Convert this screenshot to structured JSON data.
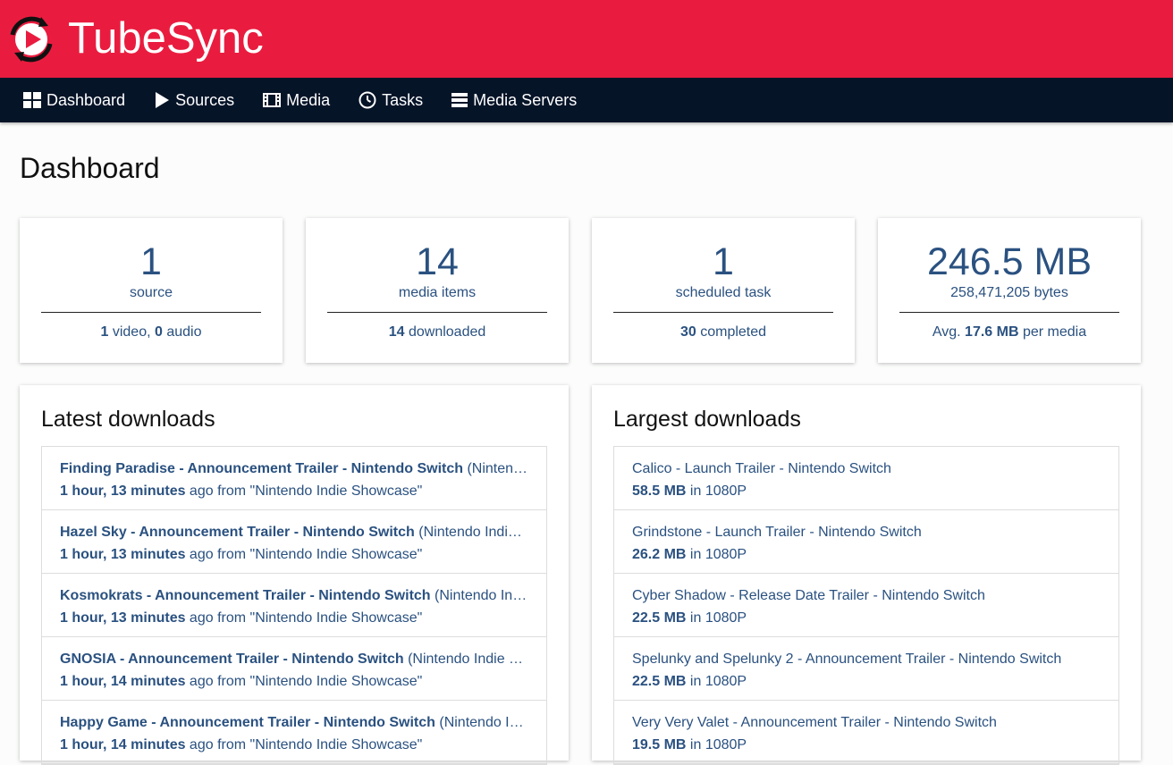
{
  "brand": {
    "name": "TubeSync"
  },
  "nav": [
    {
      "label": "Dashboard",
      "icon": "dashboard-icon"
    },
    {
      "label": "Sources",
      "icon": "play-icon"
    },
    {
      "label": "Media",
      "icon": "film-icon"
    },
    {
      "label": "Tasks",
      "icon": "clock-icon"
    },
    {
      "label": "Media Servers",
      "icon": "server-icon"
    }
  ],
  "page": {
    "title": "Dashboard"
  },
  "stats": [
    {
      "big": "1",
      "label": "source",
      "foot": [
        {
          "b": "1"
        },
        {
          "t": " video, "
        },
        {
          "b": "0"
        },
        {
          "t": " audio"
        }
      ]
    },
    {
      "big": "14",
      "label": "media items",
      "foot": [
        {
          "b": "14"
        },
        {
          "t": " downloaded"
        }
      ]
    },
    {
      "big": "1",
      "label": "scheduled task",
      "foot": [
        {
          "b": "30"
        },
        {
          "t": " completed"
        }
      ]
    },
    {
      "big": "246.5 MB",
      "label": "258,471,205 bytes",
      "foot": [
        {
          "t": "Avg. "
        },
        {
          "b": "17.6 MB"
        },
        {
          "t": " per media"
        }
      ]
    }
  ],
  "latest": {
    "title": "Latest downloads",
    "items": [
      {
        "title": "Finding Paradise - Announcement Trailer - Nintendo Switch",
        "source_paren": "(Nintendo Indie Showcase)",
        "time": "1 hour, 13 minutes",
        "from": " ago from \"Nintendo Indie Showcase\""
      },
      {
        "title": "Hazel Sky - Announcement Trailer - Nintendo Switch",
        "source_paren": "(Nintendo Indie Showcase)",
        "time": "1 hour, 13 minutes",
        "from": " ago from \"Nintendo Indie Showcase\""
      },
      {
        "title": "Kosmokrats - Announcement Trailer - Nintendo Switch",
        "source_paren": "(Nintendo Indie Showcase)",
        "time": "1 hour, 13 minutes",
        "from": " ago from \"Nintendo Indie Showcase\""
      },
      {
        "title": "GNOSIA - Announcement Trailer - Nintendo Switch",
        "source_paren": "(Nintendo Indie Showcase)",
        "time": "1 hour, 14 minutes",
        "from": " ago from \"Nintendo Indie Showcase\""
      },
      {
        "title": "Happy Game - Announcement Trailer - Nintendo Switch",
        "source_paren": "(Nintendo Indie Showcase)",
        "time": "1 hour, 14 minutes",
        "from": " ago from \"Nintendo Indie Showcase\""
      }
    ]
  },
  "largest": {
    "title": "Largest downloads",
    "items": [
      {
        "title": "Calico - Launch Trailer - Nintendo Switch",
        "size": "58.5 MB",
        "res": " in 1080P"
      },
      {
        "title": "Grindstone - Launch Trailer - Nintendo Switch",
        "size": "26.2 MB",
        "res": " in 1080P"
      },
      {
        "title": "Cyber Shadow - Release Date Trailer - Nintendo Switch",
        "size": "22.5 MB",
        "res": " in 1080P"
      },
      {
        "title": "Spelunky and Spelunky 2 - Announcement Trailer - Nintendo Switch",
        "size": "22.5 MB",
        "res": " in 1080P"
      },
      {
        "title": "Very Very Valet - Announcement Trailer - Nintendo Switch",
        "size": "19.5 MB",
        "res": " in 1080P"
      }
    ]
  },
  "colors": {
    "brand_red": "#e91c3f",
    "nav_bg": "#061428",
    "link_blue": "#2a5180"
  }
}
